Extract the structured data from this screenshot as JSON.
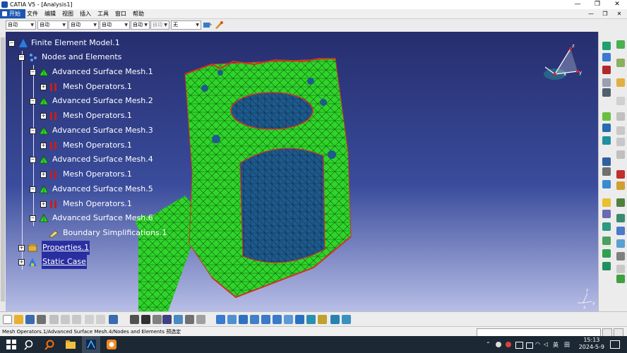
{
  "window": {
    "title": "CATIA V5 - [Analysis1]",
    "min": "—",
    "max": "❐",
    "close": "✕"
  },
  "menubar": {
    "start": "开始",
    "items": [
      "文件",
      "编辑",
      "视图",
      "插入",
      "工具",
      "窗口",
      "帮助"
    ],
    "mdi": [
      "—",
      "❐",
      "✕"
    ]
  },
  "toolbar": {
    "combos": [
      {
        "value": "自动",
        "disabled": false
      },
      {
        "value": "自动",
        "disabled": false
      },
      {
        "value": "自动",
        "disabled": false
      },
      {
        "value": "自动",
        "disabled": false
      },
      {
        "value": "自动",
        "disabled": false
      },
      {
        "value": "自动",
        "disabled": true
      },
      {
        "value": "无",
        "disabled": false
      }
    ]
  },
  "tree": {
    "root": "Finite Element Model.1",
    "nodes_and_elements": "Nodes and Elements",
    "meshes": [
      {
        "label": "Advanced Surface Mesh.1",
        "child": "Mesh Operators.1"
      },
      {
        "label": "Advanced Surface Mesh.2",
        "child": "Mesh Operators.1"
      },
      {
        "label": "Advanced Surface Mesh.3",
        "child": "Mesh Operators.1"
      },
      {
        "label": "Advanced Surface Mesh.4",
        "child": "Mesh Operators.1"
      },
      {
        "label": "Advanced Surface Mesh.5",
        "child": "Mesh Operators.1"
      },
      {
        "label": "Advanced Surface Mesh.6",
        "child": "Boundary Simplifications.1"
      }
    ],
    "properties": "Properties.1",
    "static_case": "Static Case"
  },
  "compass_labels": {
    "z": "z",
    "x": "x",
    "y": "y"
  },
  "axis_labels": {
    "z": "z",
    "x": "x",
    "y": "y"
  },
  "status": {
    "text": "Mesh Operators.1/Advanced Surface Mesh.4/Nodes and Elements 预选定"
  },
  "taskbar": {
    "time": "15:13",
    "date": "2024-5-9",
    "ime": "英",
    "ime2": "田"
  },
  "colors": {
    "mesh_green": "#2fd42a",
    "mesh_blue": "#1e5a8c",
    "selection": "#2a2fa0"
  }
}
